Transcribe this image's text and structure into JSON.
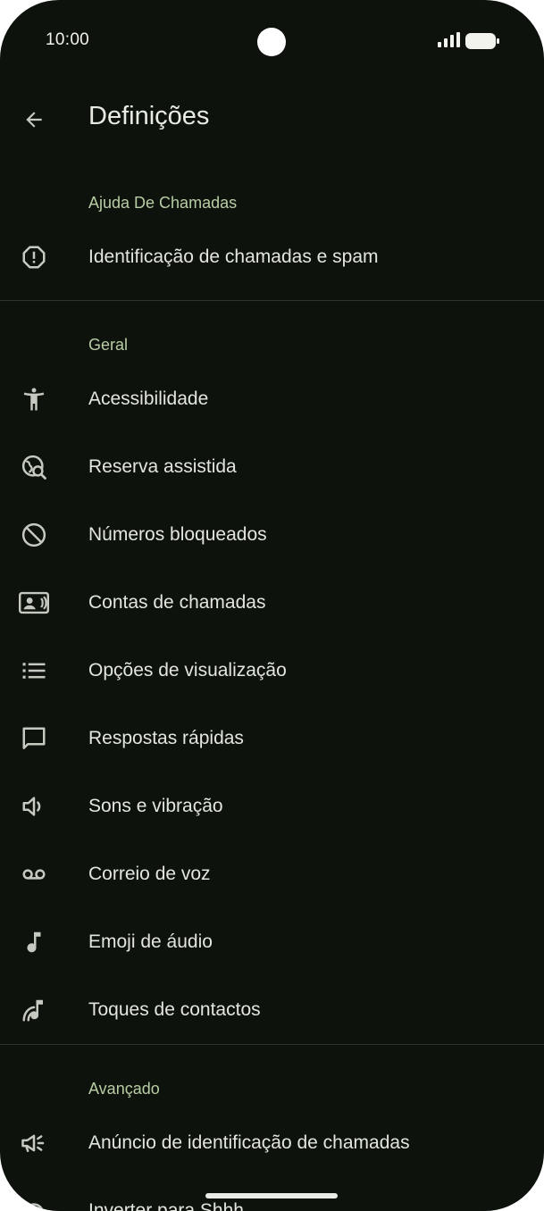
{
  "status_bar": {
    "time": "10:00",
    "signal_icon": "cell-signal-icon",
    "battery_icon": "battery-icon"
  },
  "header": {
    "title": "Definições",
    "back_icon": "arrow-back-icon"
  },
  "colors": {
    "background": "#0d120d",
    "text": "#e3e6dd",
    "section_accent": "#b8cda4",
    "icon": "#c5c9bf",
    "divider": "#2d342c"
  },
  "sections": [
    {
      "label": "Ajuda De Chamadas",
      "items": [
        {
          "label": "Identificação de chamadas e spam",
          "icon": "spam-alert-icon"
        }
      ]
    },
    {
      "label": "Geral",
      "items": [
        {
          "label": "Acessibilidade",
          "icon": "accessibility-icon"
        },
        {
          "label": "Reserva assistida",
          "icon": "travel-explore-icon"
        },
        {
          "label": "Números bloqueados",
          "icon": "block-icon"
        },
        {
          "label": "Contas de chamadas",
          "icon": "contact-card-icon"
        },
        {
          "label": "Opções de visualização",
          "icon": "list-icon"
        },
        {
          "label": "Respostas rápidas",
          "icon": "message-icon"
        },
        {
          "label": "Sons e vibração",
          "icon": "volume-icon"
        },
        {
          "label": "Correio de voz",
          "icon": "voicemail-icon"
        },
        {
          "label": "Emoji de áudio",
          "icon": "music-note-icon"
        },
        {
          "label": "Toques de contactos",
          "icon": "ringtone-icon"
        }
      ]
    },
    {
      "label": "Avançado",
      "items": [
        {
          "label": "Anúncio de identificação de chamadas",
          "icon": "announcement-icon"
        },
        {
          "label": "Inverter para Shhh",
          "icon": "flip-icon"
        }
      ]
    }
  ]
}
